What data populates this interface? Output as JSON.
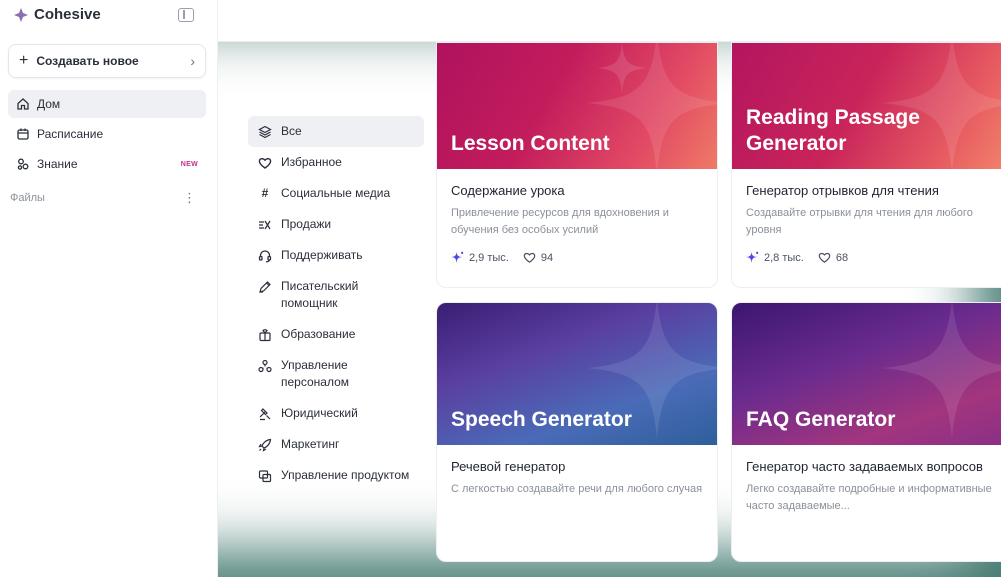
{
  "app": {
    "name": "Cohesive"
  },
  "sidebar": {
    "new_button": "Создавать новое",
    "items": [
      {
        "label": "Дом",
        "icon": "home-icon",
        "active": true
      },
      {
        "label": "Расписание",
        "icon": "calendar-icon"
      },
      {
        "label": "Знание",
        "icon": "knowledge-icon",
        "badge": "NEW"
      }
    ],
    "files_label": "Файлы"
  },
  "categories": [
    {
      "label": "Все",
      "icon": "layers-icon",
      "active": true
    },
    {
      "label": "Избранное",
      "icon": "heart-icon"
    },
    {
      "label": "Социальные медиа",
      "icon": "hash-icon"
    },
    {
      "label": "Продажи",
      "icon": "sales-icon"
    },
    {
      "label": "Поддерживать",
      "icon": "headset-icon"
    },
    {
      "label": "Писательский помощник",
      "icon": "pen-icon"
    },
    {
      "label": "Образование",
      "icon": "education-icon"
    },
    {
      "label": "Управление персоналом",
      "icon": "people-icon"
    },
    {
      "label": "Юридический",
      "icon": "gavel-icon"
    },
    {
      "label": "Маркетинг",
      "icon": "rocket-icon"
    },
    {
      "label": "Управление продуктом",
      "icon": "product-icon"
    }
  ],
  "cards": [
    {
      "hero_title": "Lesson Content",
      "title": "Содержание урока",
      "desc": "Привлечение ресурсов для вдохновения и обучения без особых усилий",
      "uses": "2,9 тыс.",
      "likes": "94",
      "theme_color": "#c21c5c"
    },
    {
      "hero_title": "Reading Passage Generator",
      "title": "Генератор отрывков для чтения",
      "desc": "Создавайте отрывки для чтения для любого уровня",
      "uses": "2,8 тыс.",
      "likes": "68",
      "theme_color": "#c9245a"
    },
    {
      "hero_title": "Speech Generator",
      "title": "Речевой генератор",
      "desc": "С легкостью создавайте речи для любого случая",
      "theme_color": "#5a3fa1"
    },
    {
      "hero_title": "FAQ Generator",
      "title": "Генератор часто задаваемых вопросов",
      "desc": "Легко создавайте подробные и информативные часто задаваемые...",
      "theme_color": "#6a2b8e"
    }
  ],
  "colors": {
    "accent": "#c0328a",
    "sparkle": "#4f46e5"
  }
}
